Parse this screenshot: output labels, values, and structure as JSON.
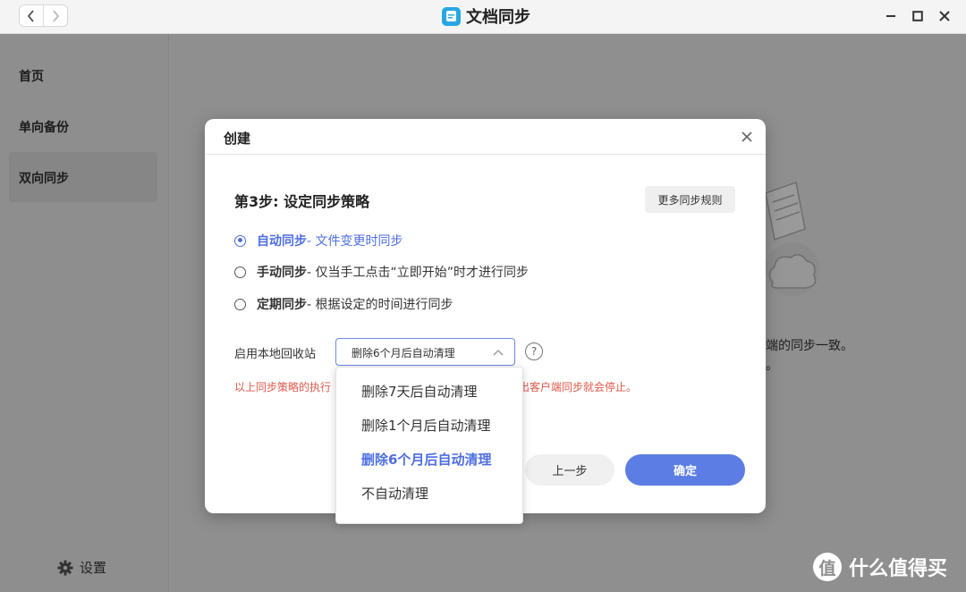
{
  "window": {
    "title": "文档同步",
    "back_icon": "chevron-left-icon",
    "forward_icon": "chevron-right-icon",
    "minimize_icon": "minimize-icon",
    "maximize_icon": "maximize-icon",
    "close_icon": "close-icon"
  },
  "sidebar": {
    "items": [
      {
        "label": "首页"
      },
      {
        "label": "单向备份"
      },
      {
        "label": "双向同步"
      }
    ],
    "active_index": 2,
    "settings_label": "设置"
  },
  "background": {
    "line1": "端的同步一致。",
    "line2": "。"
  },
  "dialog": {
    "title": "创建",
    "step_title": "第3步: 设定同步策略",
    "more_rules_label": "更多同步规则",
    "options": [
      {
        "label": "自动同步",
        "desc": " - 文件变更时同步",
        "selected": true
      },
      {
        "label": "手动同步",
        "desc": " - 仅当手工点击“立即开始”时才进行同步",
        "selected": false
      },
      {
        "label": "定期同步",
        "desc": " - 根据设定的时间进行同步",
        "selected": false
      }
    ],
    "recycle_label": "启用本地回收站",
    "recycle_value": "删除6个月后自动清理",
    "help_glyph": "?",
    "warning_left": "以上同步策略的执行",
    "warning_right": "出客户端同步就会停止。",
    "prev_label": "上一步",
    "ok_label": "确定",
    "accent_color": "#5c7de3",
    "warning_color": "#e0584a"
  },
  "dropdown": {
    "options": [
      {
        "label": "删除7天后自动清理"
      },
      {
        "label": "删除1个月后自动清理"
      },
      {
        "label": "删除6个月后自动清理"
      },
      {
        "label": "不自动清理"
      }
    ],
    "selected_index": 2
  },
  "watermark": {
    "glyph": "值",
    "text": "什么值得买"
  }
}
